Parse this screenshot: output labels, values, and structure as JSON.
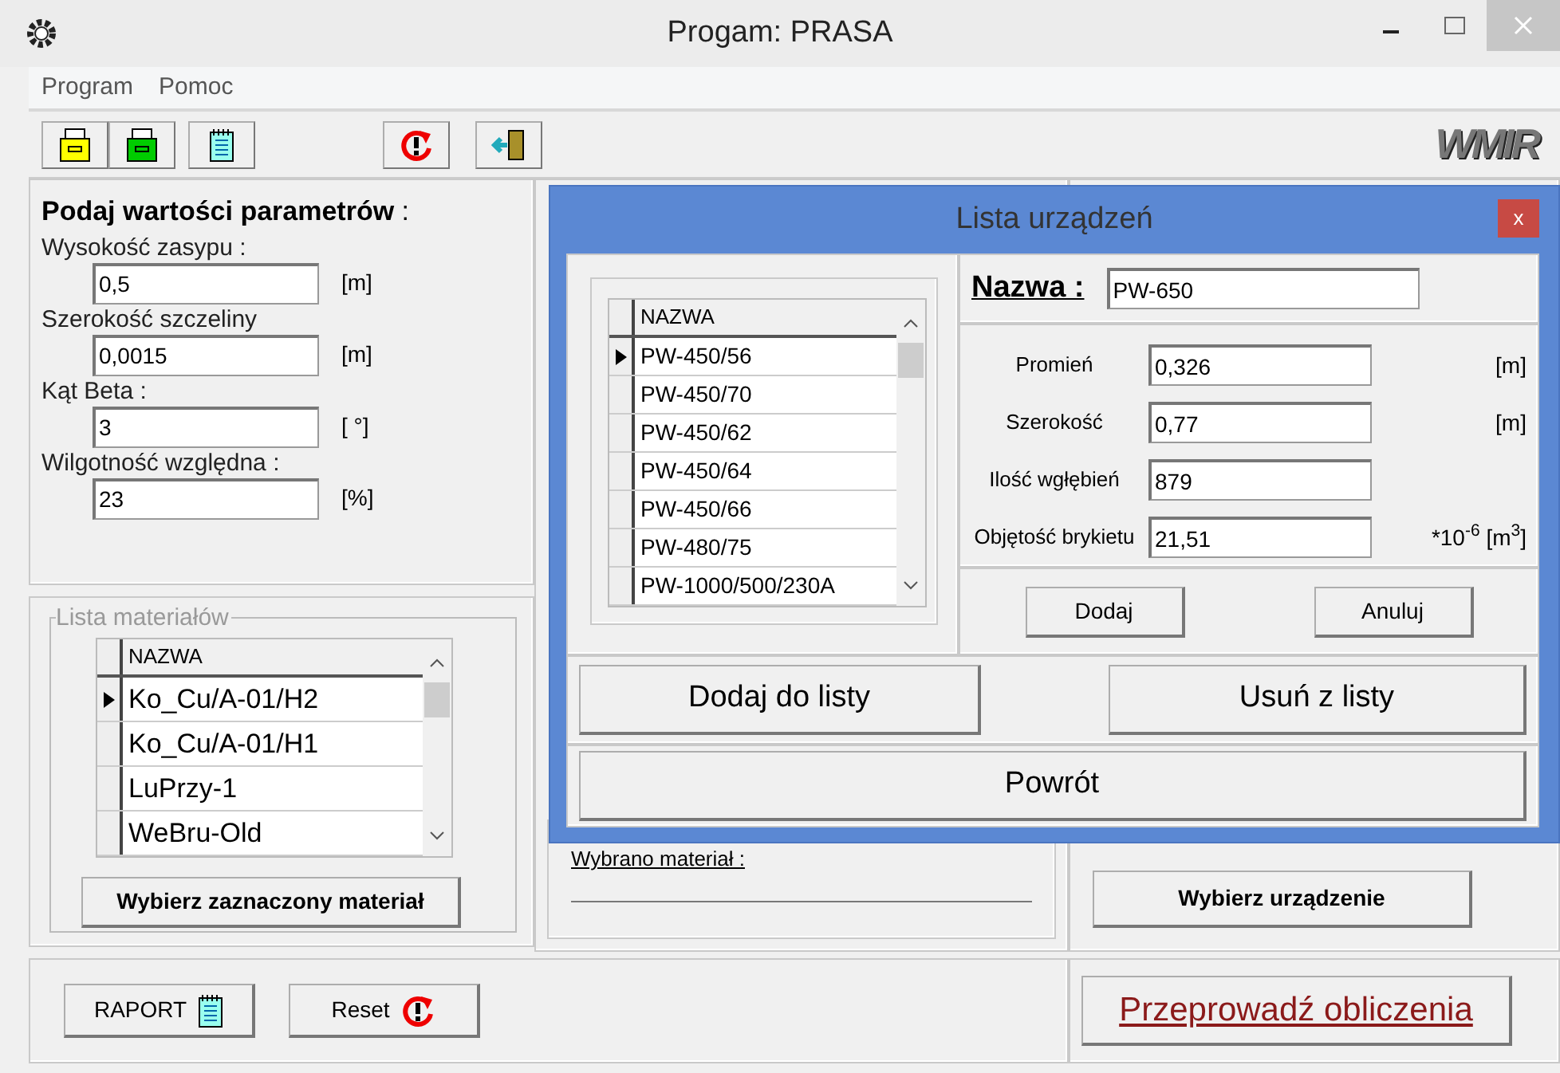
{
  "window": {
    "title": "Progam: PRASA"
  },
  "menu": [
    {
      "label": "Program"
    },
    {
      "label": "Pomoc"
    }
  ],
  "toolbar": [
    {
      "kind": "open"
    },
    {
      "kind": "save"
    },
    {
      "kind": "report"
    },
    {
      "kind": "reset"
    },
    {
      "kind": "exit"
    }
  ],
  "logo": "WMIR",
  "parameters": {
    "title": "**Podaj wartości parametrów** :",
    "fields": [
      {
        "label": "Wysokość zasypu :",
        "value": "0,5",
        "unit": "[m]"
      },
      {
        "label": "Szerokość szczeliny",
        "value": "0,0015",
        "unit": "[m]"
      },
      {
        "label": "Kąt Beta :",
        "value": "3",
        "unit": "[ °]"
      },
      {
        "label": "Wilgotność względna :",
        "value": "23",
        "unit": "[%]"
      }
    ]
  },
  "materials": {
    "title": "Lista materiałów",
    "column": "NAZWA",
    "rows": [
      {
        "name": "Ko_Cu/A-01/H2",
        "selected": true
      },
      {
        "name": "Ko_Cu/A-01/H1",
        "selected": false
      },
      {
        "name": "LuPrzy-1",
        "selected": false
      },
      {
        "name": "WeBru-Old",
        "selected": false
      }
    ],
    "button": "Wybierz zaznaczony materiał"
  },
  "middle": {
    "label": "Wybrano materiał :"
  },
  "right": {
    "button": "Wybierz urządzenie"
  },
  "bottom": {
    "report": "RAPORT",
    "reset": "Reset",
    "compute": "Przeprowadź obliczenia"
  },
  "dialog": {
    "title": "Lista urządzeń",
    "close": "x",
    "column": "NAZWA",
    "rows": [
      {
        "name": "PW-450/56",
        "selected": true
      },
      {
        "name": "PW-450/70",
        "selected": false
      },
      {
        "name": "PW-450/62",
        "selected": false
      },
      {
        "name": "PW-450/64",
        "selected": false
      },
      {
        "name": "PW-450/66",
        "selected": false
      },
      {
        "name": "PW-480/75",
        "selected": false
      },
      {
        "name": "PW-1000/500/230A",
        "selected": false
      }
    ],
    "name_label": "Nazwa :",
    "name_value": "PW-650",
    "fields": [
      {
        "label": "Promień",
        "value": "0,326",
        "unit": "[m]"
      },
      {
        "label": "Szerokość",
        "value": "0,77",
        "unit": "[m]"
      },
      {
        "label": "Ilość wgłębień",
        "value": "879"
      },
      {
        "label": "Objętość brykietu",
        "value": "21,51",
        "unit": "*10$^{-6}$ [m$^{3}$]"
      }
    ],
    "add": "Dodaj",
    "cancel": "Anuluj",
    "add_to_list": "Dodaj do listy",
    "remove": "Usuń z listy",
    "back": "Powrót"
  }
}
